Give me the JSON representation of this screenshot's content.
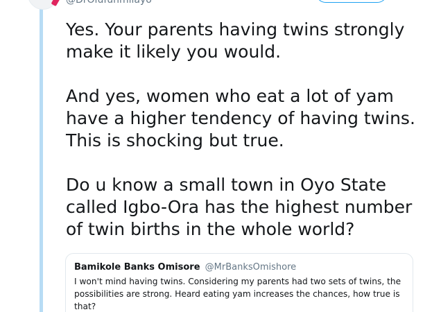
{
  "author": {
    "handle": "@DrOlufunmilayo"
  },
  "follow_button": {
    "label": ""
  },
  "tweet": {
    "paragraphs": [
      "Yes. Your parents having twins strongly\nmake it likely you would.",
      "And yes, women who eat a lot of yam\nhave a higher tendency of having twins.\nThis is shocking but true.",
      "Do u know a small town in Oyo State\ncalled Igbo-Ora has the highest number\nof twin births in the whole world?"
    ]
  },
  "quoted_tweet": {
    "name": "Bamikole Banks Omisore",
    "handle": "@MrBanksOmishore",
    "text": "I won't mind having twins. Considering my parents had two sets of twins, the possibilities are strong. Heard eating yam increases the chances, how true is that?"
  },
  "colors": {
    "thread_line": "#b8dcf5",
    "accent": "#1da1f2",
    "text": "#14171a",
    "muted": "#657786",
    "border": "#e1e8ed"
  }
}
